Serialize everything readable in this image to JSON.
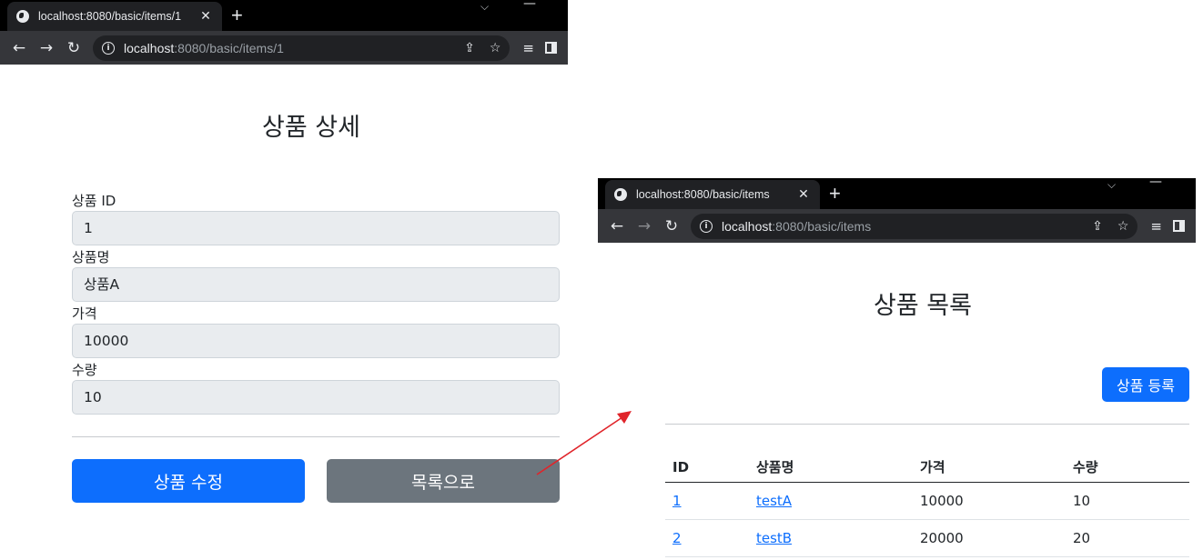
{
  "left_window": {
    "tab_title": "localhost:8080/basic/items/1",
    "tab_close": "✕",
    "new_tab": "+",
    "url_host": "localhost",
    "url_path": ":8080/basic/items/1",
    "page": {
      "title": "상품 상세",
      "fields": [
        {
          "label": "상품 ID",
          "value": "1"
        },
        {
          "label": "상품명",
          "value": "상품A"
        },
        {
          "label": "가격",
          "value": "10000"
        },
        {
          "label": "수량",
          "value": "10"
        }
      ],
      "edit_button": "상품 수정",
      "list_button": "목록으로"
    }
  },
  "right_window": {
    "tab_title": "localhost:8080/basic/items",
    "tab_close": "✕",
    "new_tab": "+",
    "url_host": "localhost",
    "url_path": ":8080/basic/items",
    "page": {
      "title": "상품 목록",
      "add_button": "상품 등록",
      "table": {
        "headers": [
          "ID",
          "상품명",
          "가격",
          "수량"
        ],
        "rows": [
          {
            "id": "1",
            "name": "testA",
            "price": "10000",
            "quantity": "10"
          },
          {
            "id": "2",
            "name": "testB",
            "price": "20000",
            "quantity": "20"
          }
        ]
      }
    }
  },
  "colors": {
    "primary": "#0d6efd",
    "secondary": "#6c757d",
    "arrow": "#e0242a"
  }
}
